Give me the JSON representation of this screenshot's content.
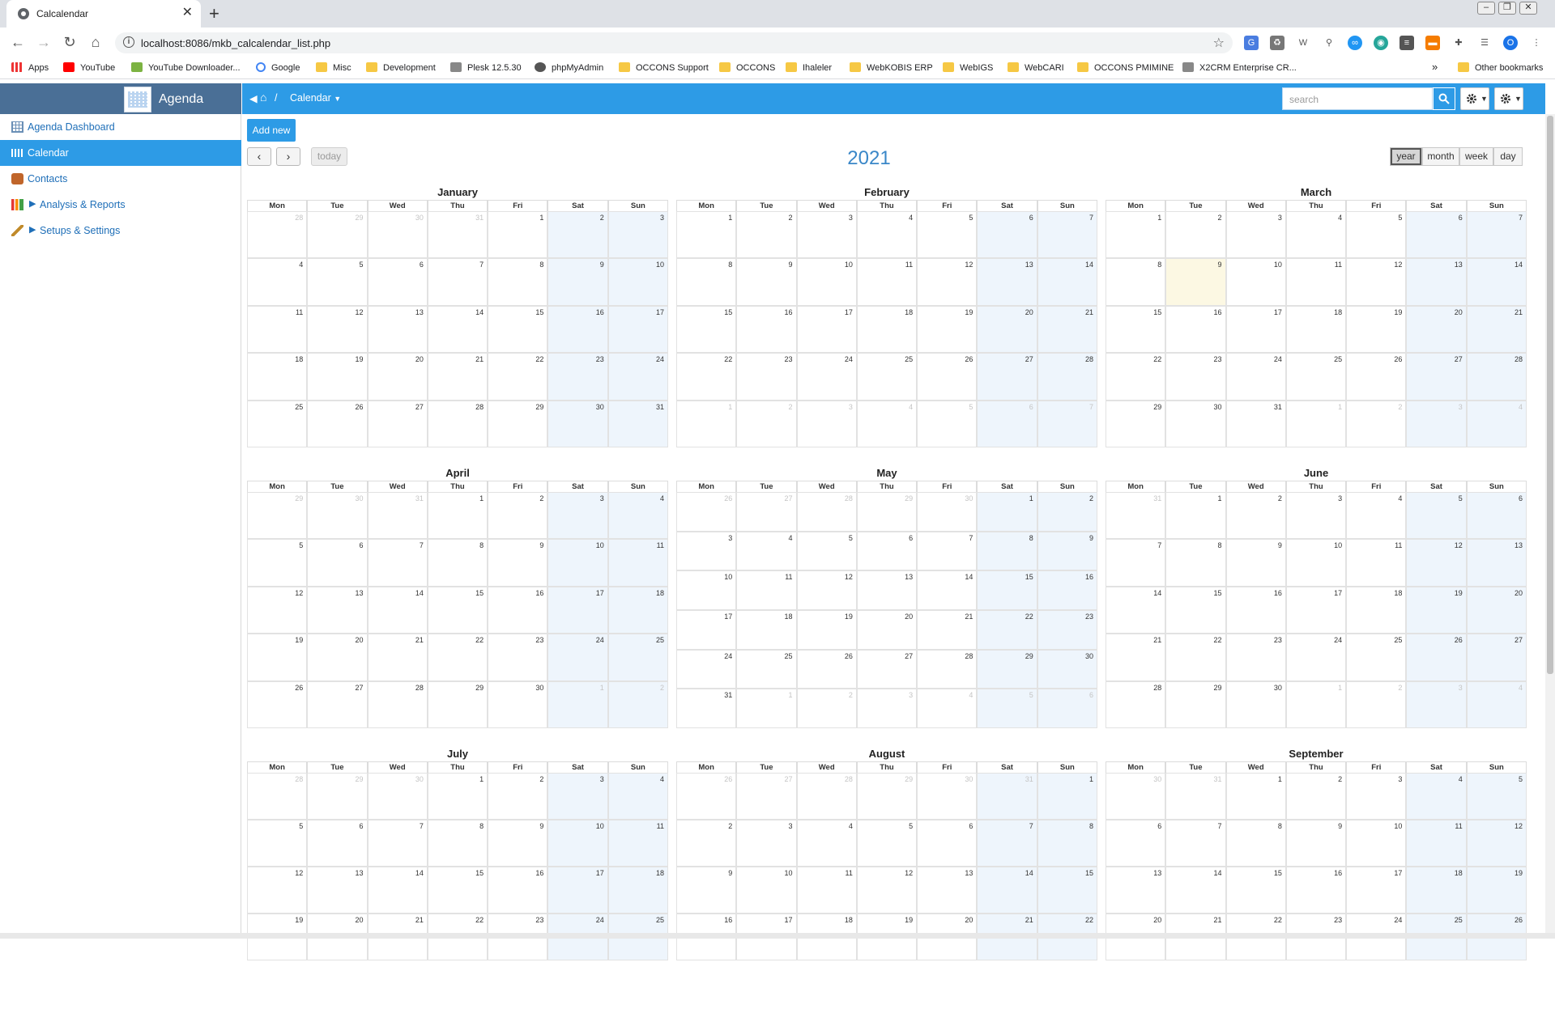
{
  "browser": {
    "tab_title": "Calcalendar",
    "url": "localhost:8086/mkb_calcalendar_list.php",
    "bookmarks": [
      "Apps",
      "YouTube",
      "YouTube Downloader...",
      "Google",
      "Misc",
      "Development",
      "Plesk 12.5.30",
      "phpMyAdmin",
      "OCCONS Support",
      "OCCONS",
      "Ihaleler",
      "WebKOBIS ERP",
      "WebIGS",
      "WebCARI",
      "OCCONS PMIMINE",
      "X2CRM Enterprise CR..."
    ],
    "other_bookmarks": "Other bookmarks",
    "more_bookmarks": "»",
    "avatar_initial": "O"
  },
  "sidebar": {
    "title": "Agenda",
    "items": [
      {
        "label": "Agenda Dashboard"
      },
      {
        "label": "Calendar"
      },
      {
        "label": "Contacts"
      },
      {
        "label": "Analysis & Reports"
      },
      {
        "label": "Setups & Settings"
      }
    ]
  },
  "topbar": {
    "breadcrumb_sep": "/",
    "breadcrumb_current": "Calendar",
    "search_placeholder": "search"
  },
  "calendar": {
    "add_new": "Add new",
    "prev": "‹",
    "next": "›",
    "today": "today",
    "title": "2021",
    "views": [
      "year",
      "month",
      "week",
      "day"
    ],
    "active_view": "year",
    "weekdays": [
      "Mon",
      "Tue",
      "Wed",
      "Thu",
      "Fri",
      "Sat",
      "Sun"
    ],
    "months": [
      {
        "name": "January",
        "weeks": [
          [
            28,
            29,
            30,
            31,
            1,
            2,
            3
          ],
          [
            4,
            5,
            6,
            7,
            8,
            9,
            10
          ],
          [
            11,
            12,
            13,
            14,
            15,
            16,
            17
          ],
          [
            18,
            19,
            20,
            21,
            22,
            23,
            24
          ],
          [
            25,
            26,
            27,
            28,
            29,
            30,
            31
          ]
        ],
        "lead": 4,
        "trail": 0
      },
      {
        "name": "February",
        "weeks": [
          [
            1,
            2,
            3,
            4,
            5,
            6,
            7
          ],
          [
            8,
            9,
            10,
            11,
            12,
            13,
            14
          ],
          [
            15,
            16,
            17,
            18,
            19,
            20,
            21
          ],
          [
            22,
            23,
            24,
            25,
            26,
            27,
            28
          ],
          [
            1,
            2,
            3,
            4,
            5,
            6,
            7
          ]
        ],
        "lead": 0,
        "trail": 7
      },
      {
        "name": "March",
        "weeks": [
          [
            1,
            2,
            3,
            4,
            5,
            6,
            7
          ],
          [
            8,
            9,
            10,
            11,
            12,
            13,
            14
          ],
          [
            15,
            16,
            17,
            18,
            19,
            20,
            21
          ],
          [
            22,
            23,
            24,
            25,
            26,
            27,
            28
          ],
          [
            29,
            30,
            31,
            1,
            2,
            3,
            4
          ]
        ],
        "lead": 0,
        "trail": 4,
        "today": [
          1,
          1
        ]
      },
      {
        "name": "April",
        "weeks": [
          [
            29,
            30,
            31,
            1,
            2,
            3,
            4
          ],
          [
            5,
            6,
            7,
            8,
            9,
            10,
            11
          ],
          [
            12,
            13,
            14,
            15,
            16,
            17,
            18
          ],
          [
            19,
            20,
            21,
            22,
            23,
            24,
            25
          ],
          [
            26,
            27,
            28,
            29,
            30,
            1,
            2
          ]
        ],
        "lead": 3,
        "trail": 2
      },
      {
        "name": "May",
        "weeks": [
          [
            26,
            27,
            28,
            29,
            30,
            1,
            2
          ],
          [
            3,
            4,
            5,
            6,
            7,
            8,
            9
          ],
          [
            10,
            11,
            12,
            13,
            14,
            15,
            16
          ],
          [
            17,
            18,
            19,
            20,
            21,
            22,
            23
          ],
          [
            24,
            25,
            26,
            27,
            28,
            29,
            30
          ],
          [
            31,
            1,
            2,
            3,
            4,
            5,
            6
          ]
        ],
        "lead": 5,
        "trail": 6
      },
      {
        "name": "June",
        "weeks": [
          [
            31,
            1,
            2,
            3,
            4,
            5,
            6
          ],
          [
            7,
            8,
            9,
            10,
            11,
            12,
            13
          ],
          [
            14,
            15,
            16,
            17,
            18,
            19,
            20
          ],
          [
            21,
            22,
            23,
            24,
            25,
            26,
            27
          ],
          [
            28,
            29,
            30,
            1,
            2,
            3,
            4
          ]
        ],
        "lead": 1,
        "trail": 4
      },
      {
        "name": "July",
        "weeks": [
          [
            28,
            29,
            30,
            1,
            2,
            3,
            4
          ],
          [
            5,
            6,
            7,
            8,
            9,
            10,
            11
          ],
          [
            12,
            13,
            14,
            15,
            16,
            17,
            18
          ],
          [
            19,
            20,
            21,
            22,
            23,
            24,
            25
          ]
        ],
        "lead": 3,
        "trail": 0
      },
      {
        "name": "August",
        "weeks": [
          [
            26,
            27,
            28,
            29,
            30,
            31,
            1
          ],
          [
            2,
            3,
            4,
            5,
            6,
            7,
            8
          ],
          [
            9,
            10,
            11,
            12,
            13,
            14,
            15
          ],
          [
            16,
            17,
            18,
            19,
            20,
            21,
            22
          ]
        ],
        "lead": 6,
        "trail": 0
      },
      {
        "name": "September",
        "weeks": [
          [
            30,
            31,
            1,
            2,
            3,
            4,
            5
          ],
          [
            6,
            7,
            8,
            9,
            10,
            11,
            12
          ],
          [
            13,
            14,
            15,
            16,
            17,
            18,
            19
          ],
          [
            20,
            21,
            22,
            23,
            24,
            25,
            26
          ]
        ],
        "lead": 2,
        "trail": 0
      }
    ]
  }
}
